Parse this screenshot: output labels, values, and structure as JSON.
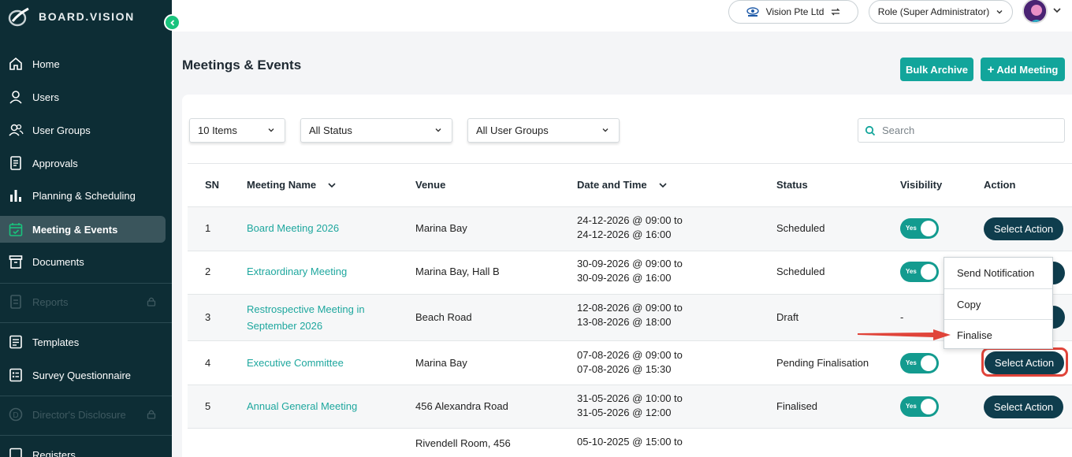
{
  "app": {
    "brand": "BOARD.VISION"
  },
  "sidebar": {
    "items": [
      {
        "label": "Home",
        "icon": "home-icon"
      },
      {
        "label": "Users",
        "icon": "user-icon"
      },
      {
        "label": "User Groups",
        "icon": "users-icon"
      },
      {
        "label": "Approvals",
        "icon": "document-icon"
      },
      {
        "label": "Planning & Scheduling",
        "icon": "bar-chart-icon"
      },
      {
        "label": "Meeting & Events",
        "icon": "calendar-check-icon",
        "active": true
      },
      {
        "label": "Documents",
        "icon": "archive-icon"
      },
      {
        "label": "Reports",
        "icon": "report-icon",
        "locked": true
      },
      {
        "label": "Templates",
        "icon": "template-icon"
      },
      {
        "label": "Survey Questionnaire",
        "icon": "survey-icon"
      },
      {
        "label": "Director's Disclosure",
        "icon": "disclosure-icon",
        "locked": true
      },
      {
        "label": "Registers",
        "icon": "register-icon"
      }
    ]
  },
  "header": {
    "organization": "Vision Pte Ltd",
    "role": "Role (Super Administrator)"
  },
  "page": {
    "title": "Meetings & Events",
    "bulk_archive_label": "Bulk Archive",
    "add_meeting_label": "Add Meeting"
  },
  "filters": {
    "items_per_page": "10 Items",
    "status": "All Status",
    "user_groups": "All User Groups",
    "search_placeholder": "Search"
  },
  "table": {
    "columns": [
      "SN",
      "Meeting Name",
      "Venue",
      "Date and Time",
      "Status",
      "Visibility",
      "Action"
    ],
    "toggle_label": "Yes",
    "action_label": "Select Action",
    "rows": [
      {
        "sn": "1",
        "name": "Board Meeting 2026",
        "venue": "Marina Bay",
        "date1": "24-12-2026 @ 09:00 to",
        "date2": "24-12-2026 @ 16:00",
        "status": "Scheduled",
        "visibility": "Yes"
      },
      {
        "sn": "2",
        "name": "Extraordinary Meeting",
        "venue": "Marina Bay, Hall B",
        "date1": "30-09-2026 @ 09:00 to",
        "date2": "30-09-2026 @ 16:00",
        "status": "Scheduled",
        "visibility": "Yes"
      },
      {
        "sn": "3",
        "name": "Restrospective Meeting in September 2026",
        "venue": "Beach Road",
        "date1": "12-08-2026 @ 09:00 to",
        "date2": "13-08-2026 @ 18:00",
        "status": "Draft",
        "visibility": "-"
      },
      {
        "sn": "4",
        "name": "Executive Committee",
        "venue": "Marina Bay",
        "date1": "07-08-2026 @ 09:00 to",
        "date2": "07-08-2026 @ 15:30",
        "status": "Pending Finalisation",
        "visibility": "Yes"
      },
      {
        "sn": "5",
        "name": "Annual General Meeting",
        "venue": "456 Alexandra Road",
        "date1": "31-05-2026 @ 10:00 to",
        "date2": "31-05-2026 @ 12:00",
        "status": "Finalised",
        "visibility": "Yes"
      },
      {
        "sn": "",
        "name": "",
        "venue": "Rivendell Room, 456",
        "date1": "05-10-2025 @ 15:00 to",
        "date2": "",
        "status": "",
        "visibility": ""
      }
    ]
  },
  "action_menu": {
    "items": [
      "Send Notification",
      "Copy",
      "Finalise"
    ]
  },
  "colors": {
    "sidebar_bg": "#0d2d35",
    "accent_teal": "#12a59b",
    "action_button": "#0f3d4d",
    "highlight_red": "#e0443a"
  }
}
